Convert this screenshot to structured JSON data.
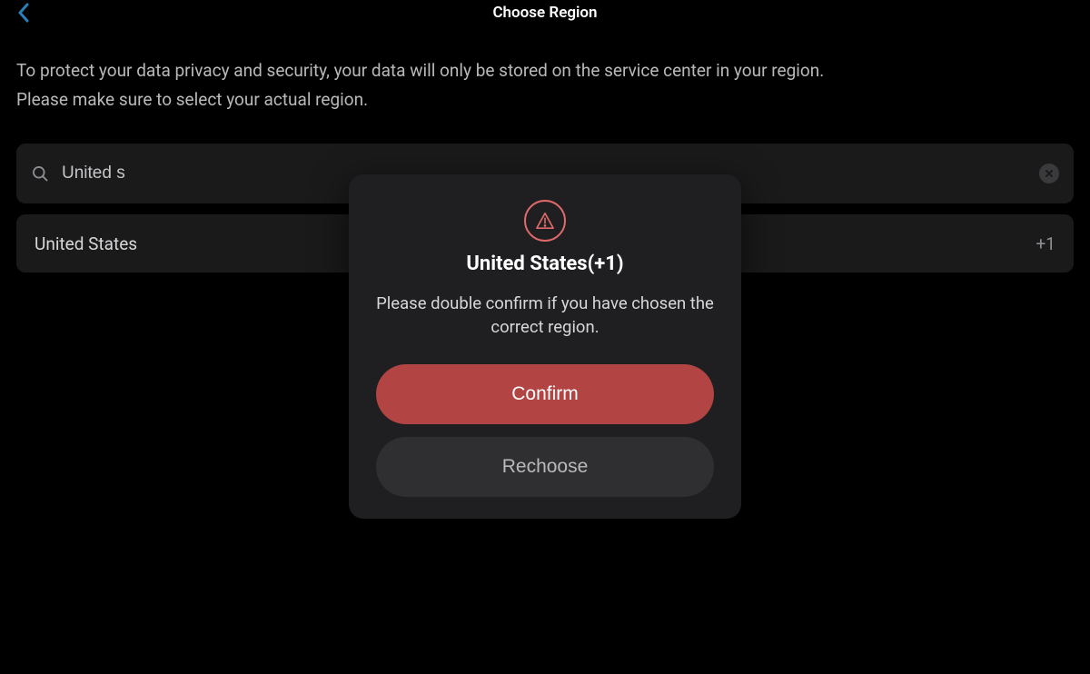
{
  "header": {
    "title": "Choose Region"
  },
  "description": {
    "line1": "To protect your data privacy and security, your data will only be stored on the service center in your region.",
    "line2": "Please make sure to select your actual region."
  },
  "search": {
    "value": "United s"
  },
  "result": {
    "name": "United States",
    "code": "+1"
  },
  "modal": {
    "title": "United States(+1)",
    "message": "Please double confirm if you have chosen the correct region.",
    "confirm_label": "Confirm",
    "rechoose_label": "Rechoose"
  }
}
